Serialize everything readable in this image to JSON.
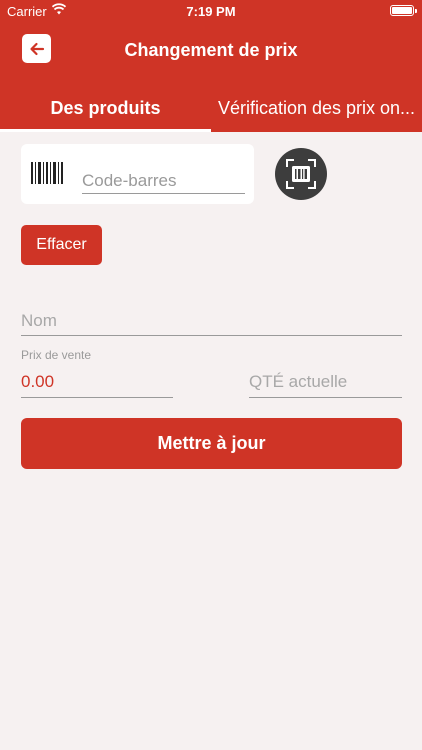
{
  "status_bar": {
    "carrier": "Carrier",
    "time": "7:19 PM"
  },
  "header": {
    "title": "Changement de prix",
    "back_icon": "arrow-left-icon",
    "background_color": "#cf3426"
  },
  "tabs": [
    {
      "label": "Des produits",
      "active": true
    },
    {
      "label": "Vérification des prix on...",
      "active": false
    }
  ],
  "barcode": {
    "icon": "barcode-icon",
    "placeholder": "Code-barres",
    "value": ""
  },
  "scan_button": {
    "icon": "barcode-scan-icon"
  },
  "clear_button": {
    "label": "Effacer"
  },
  "form": {
    "name": {
      "placeholder": "Nom",
      "value": ""
    },
    "price": {
      "label": "Prix de vente",
      "value": "0.00"
    },
    "quantity": {
      "placeholder": "QTÉ actuelle",
      "value": ""
    }
  },
  "update_button": {
    "label": "Mettre à jour"
  },
  "colors": {
    "accent": "#cf3426",
    "background": "#f6f1f1",
    "scan_button": "#3d3d3d"
  }
}
